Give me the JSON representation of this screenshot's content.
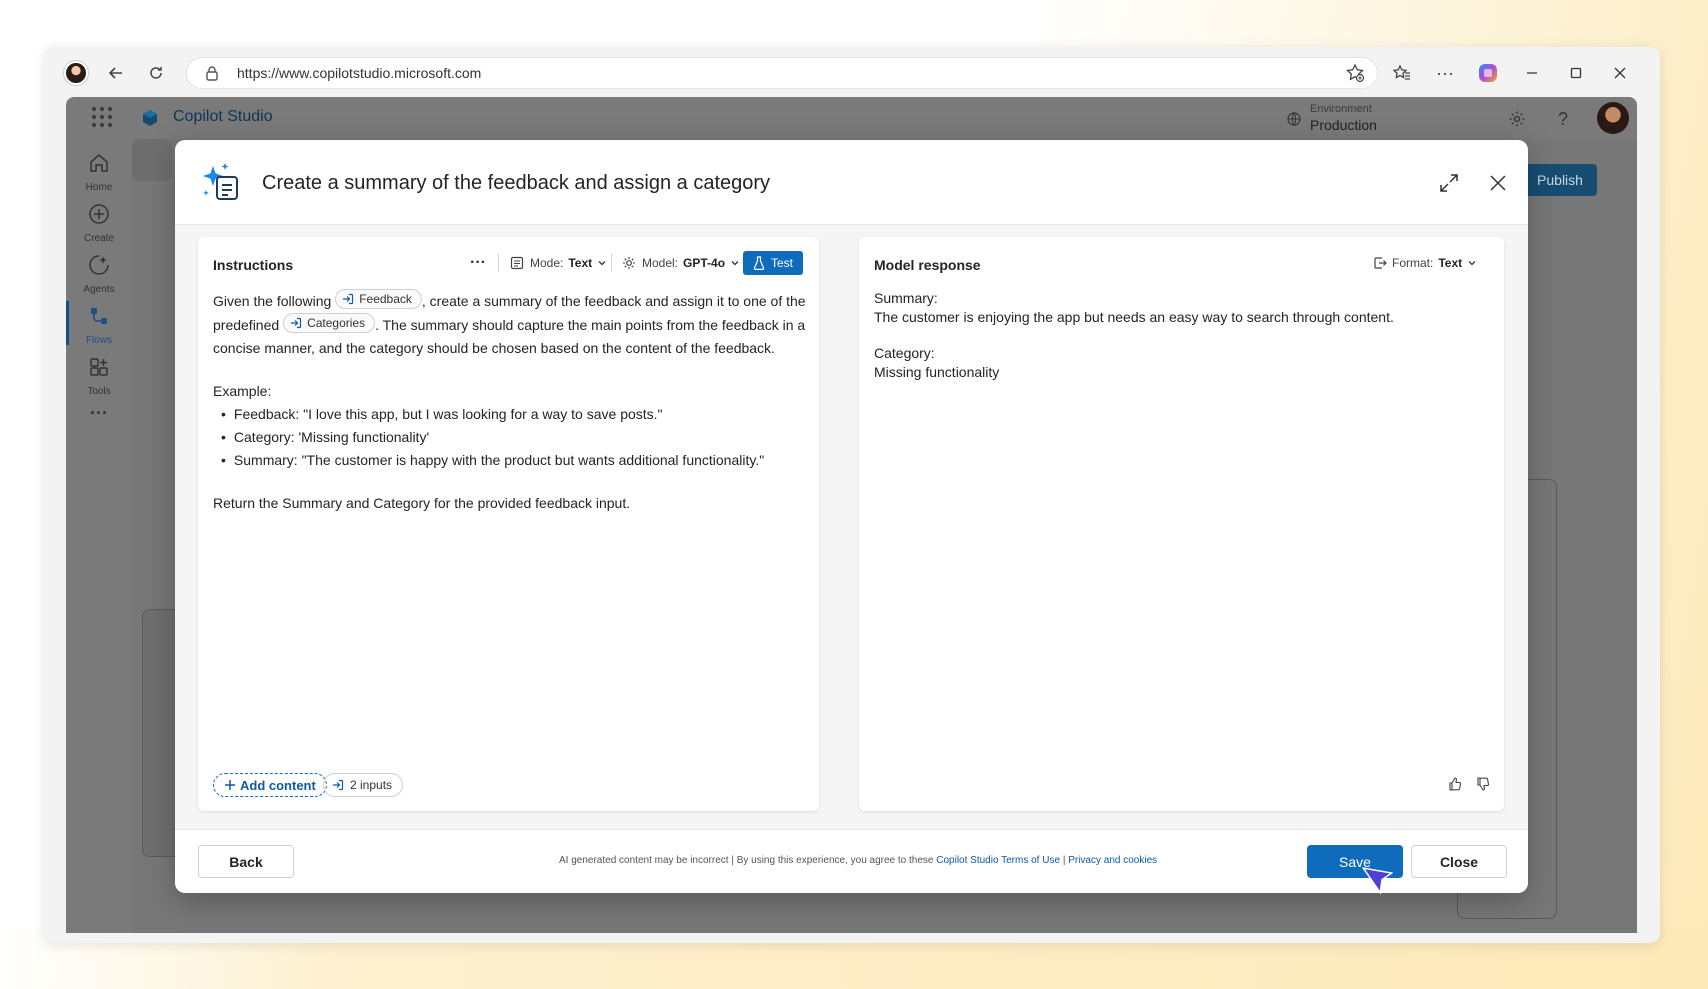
{
  "browser": {
    "url": "https://www.copilotstudio.microsoft.com"
  },
  "app": {
    "title": "Copilot Studio",
    "environment_label": "Environment",
    "environment_value": "Production",
    "publish_label": "Publish",
    "nav": [
      {
        "label": "Home",
        "icon": "home-icon"
      },
      {
        "label": "Create",
        "icon": "create-icon"
      },
      {
        "label": "Agents",
        "icon": "agents-icon"
      },
      {
        "label": "Flows",
        "icon": "flows-icon",
        "active": true
      },
      {
        "label": "Tools",
        "icon": "tools-icon"
      }
    ]
  },
  "modal": {
    "title": "Create a summary of the feedback and assign a category",
    "instructions": {
      "title": "Instructions",
      "mode_label": "Mode:",
      "mode_value": "Text",
      "model_label": "Model:",
      "model_value": "GPT-4o",
      "test_label": "Test",
      "p1_a": "Given the following",
      "chip_feedback": "Feedback",
      "p1_b": ", create a summary of the feedback and assign it to one of the",
      "p1_c": "predefined",
      "chip_categories": "Categories",
      "p1_d": ". The summary should capture the main points from the feedback in a concise manner, and the category should be chosen based on the content of the feedback.",
      "example_label": "Example:",
      "examples": [
        "Feedback: \"I love this app, but I was looking for a way to save posts.\"",
        "Category: 'Missing functionality'",
        "Summary: \"The customer is happy with the product but wants additional functionality.\""
      ],
      "closing": "Return the Summary and Category for the provided feedback input.",
      "add_content_label": "Add content",
      "inputs_label": "2 inputs"
    },
    "response": {
      "title": "Model response",
      "format_label": "Format:",
      "format_value": "Text",
      "summary_label": "Summary:",
      "summary_text": "The customer is enjoying the app but needs an easy way to search through content.",
      "category_label": "Category:",
      "category_text": "Missing functionality"
    },
    "footer": {
      "back_label": "Back",
      "disclaimer_text": "AI generated content may be incorrect | By using this experience, you agree to these",
      "terms_link": "Copilot Studio Terms of Use",
      "sep": "|",
      "privacy_link": "Privacy and cookies",
      "save_label": "Save",
      "close_label": "Close"
    }
  },
  "colors": {
    "accent": "#0f6cbd",
    "publish": "#174d73"
  }
}
